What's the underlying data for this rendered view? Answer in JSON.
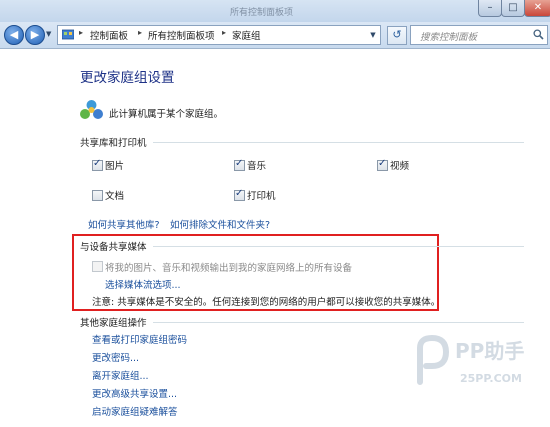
{
  "window": {
    "title": "所有控制面板项",
    "min_glyph": "–",
    "max_glyph": "□",
    "close_glyph": "✕"
  },
  "address_bar": {
    "breadcrumbs": [
      "控制面板",
      "所有控制面板项",
      "家庭组"
    ],
    "search_placeholder": "搜索控制面板"
  },
  "page": {
    "title": "更改家庭组设置",
    "homegroup_status": "此计算机属于某个家庭组。"
  },
  "sharing": {
    "heading": "共享库和打印机",
    "items": [
      {
        "label": "图片",
        "checked": true
      },
      {
        "label": "音乐",
        "checked": true
      },
      {
        "label": "视频",
        "checked": true
      },
      {
        "label": "文档",
        "checked": false
      },
      {
        "label": "打印机",
        "checked": true
      }
    ],
    "link_share_other": "如何共享其他库?",
    "link_exclude": "如何排除文件和文件夹?"
  },
  "media": {
    "heading": "与设备共享媒体",
    "stream_option": {
      "label": "将我的图片、音乐和视频输出到我的家庭网络上的所有设备",
      "checked": false,
      "enabled": false
    },
    "link_stream_options": "选择媒体流选项...",
    "note": "注意: 共享媒体是不安全的。任何连接到您的网络的用户都可以接收您的共享媒体。"
  },
  "other": {
    "heading": "其他家庭组操作",
    "links": [
      "查看或打印家庭组密码",
      "更改密码...",
      "离开家庭组...",
      "更改高级共享设置...",
      "启动家庭组疑难解答"
    ]
  },
  "watermark": {
    "brand": "PP助手",
    "url": "25PP.COM"
  },
  "colors": {
    "title_blue": "#1e3287",
    "link_blue": "#1a4f9c",
    "highlight_red": "#e02020"
  }
}
